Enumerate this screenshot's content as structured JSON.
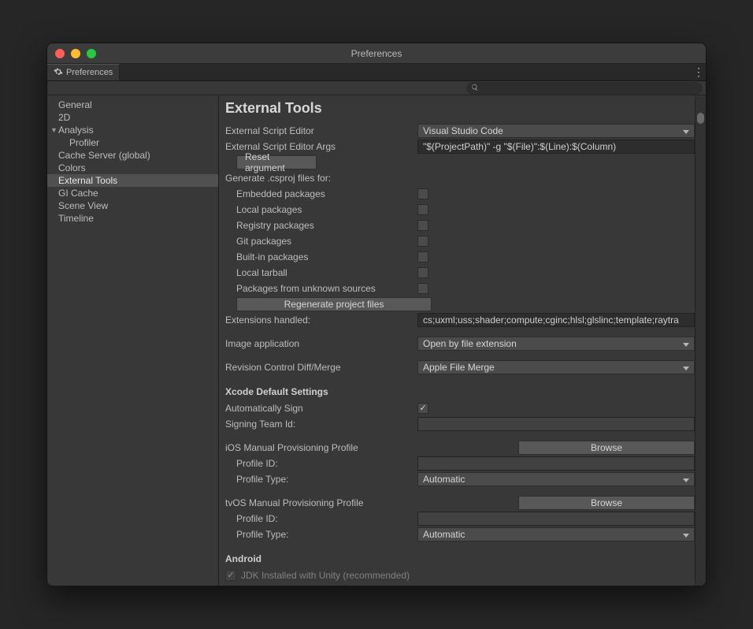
{
  "window": {
    "title": "Preferences"
  },
  "tab": {
    "label": "Preferences"
  },
  "sidebar": {
    "items": [
      {
        "label": "General"
      },
      {
        "label": "2D"
      },
      {
        "label": "Analysis",
        "expandable": true
      },
      {
        "label": "Profiler"
      },
      {
        "label": "Cache Server (global)"
      },
      {
        "label": "Colors"
      },
      {
        "label": "External Tools",
        "selected": true
      },
      {
        "label": "GI Cache"
      },
      {
        "label": "Scene View"
      },
      {
        "label": "Timeline"
      }
    ]
  },
  "page": {
    "title": "External Tools",
    "externalScriptEditor": {
      "label": "External Script Editor",
      "value": "Visual Studio Code"
    },
    "externalScriptEditorArgs": {
      "label": "External Script Editor Args",
      "value": "\"$(ProjectPath)\" -g \"$(File)\":$(Line):$(Column)"
    },
    "resetArgument": "Reset argument",
    "generateCsproj": {
      "label": "Generate .csproj files for:",
      "items": [
        {
          "label": "Embedded packages",
          "checked": false
        },
        {
          "label": "Local packages",
          "checked": false
        },
        {
          "label": "Registry packages",
          "checked": false
        },
        {
          "label": "Git packages",
          "checked": false
        },
        {
          "label": "Built-in packages",
          "checked": false
        },
        {
          "label": "Local tarball",
          "checked": false
        },
        {
          "label": "Packages from unknown sources",
          "checked": false
        }
      ],
      "regenerate": "Regenerate project files"
    },
    "extensionsHandled": {
      "label": "Extensions handled:",
      "value": "cs;uxml;uss;shader;compute;cginc;hlsl;glslinc;template;raytra"
    },
    "imageApplication": {
      "label": "Image application",
      "value": "Open by file extension"
    },
    "revisionControl": {
      "label": "Revision Control Diff/Merge",
      "value": "Apple File Merge"
    },
    "xcode": {
      "heading": "Xcode Default Settings",
      "autoSign": {
        "label": "Automatically Sign",
        "checked": true
      },
      "signingTeam": {
        "label": "Signing Team Id:",
        "value": ""
      },
      "ios": {
        "heading": "iOS Manual Provisioning Profile",
        "browse": "Browse",
        "profileId": {
          "label": "Profile ID:",
          "value": ""
        },
        "profileType": {
          "label": "Profile Type:",
          "value": "Automatic"
        }
      },
      "tvos": {
        "heading": "tvOS Manual Provisioning Profile",
        "browse": "Browse",
        "profileId": {
          "label": "Profile ID:",
          "value": ""
        },
        "profileType": {
          "label": "Profile Type:",
          "value": "Automatic"
        }
      }
    },
    "android": {
      "heading": "Android",
      "jdkInstalled": {
        "label": "JDK Installed with Unity (recommended)",
        "checked": true
      }
    }
  }
}
